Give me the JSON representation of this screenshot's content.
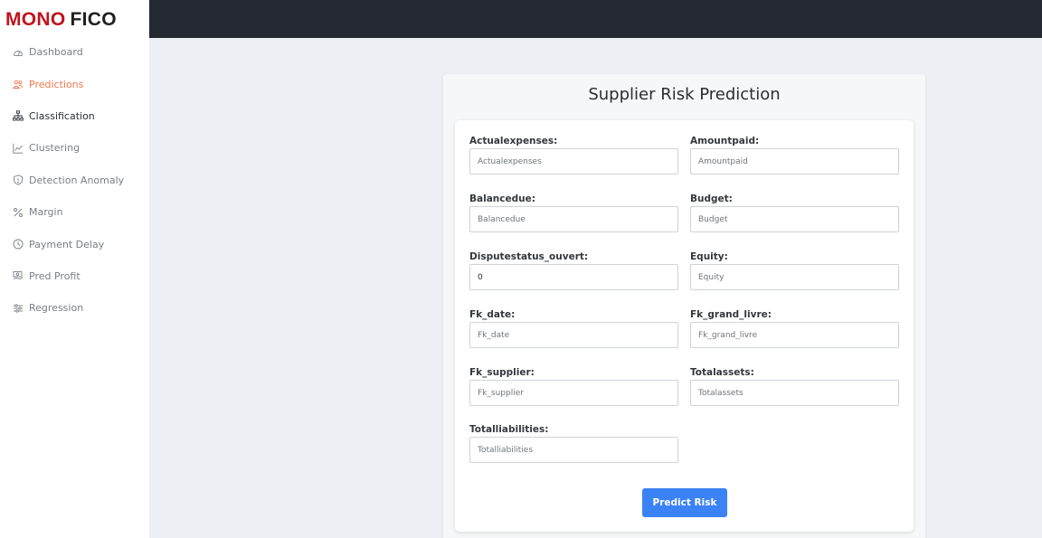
{
  "brand": {
    "part1": "MONO",
    "part2": "FICO"
  },
  "sidebar": {
    "items": [
      {
        "label": "Dashboard",
        "icon": "gauge-icon"
      },
      {
        "label": "Predictions",
        "icon": "users-icon"
      },
      {
        "label": "Classification",
        "icon": "sitemap-icon"
      },
      {
        "label": "Clustering",
        "icon": "line-chart-icon"
      },
      {
        "label": "Detection Anomaly",
        "icon": "shield-icon"
      },
      {
        "label": "Margin",
        "icon": "percent-icon"
      },
      {
        "label": "Payment Delay",
        "icon": "clock-icon"
      },
      {
        "label": "Pred Profit",
        "icon": "money-hand-icon"
      },
      {
        "label": "Regression",
        "icon": "sliders-icon"
      }
    ],
    "active": "Predictions"
  },
  "form": {
    "title": "Supplier Risk Prediction",
    "fields": [
      {
        "label": "Actualexpenses:",
        "placeholder": "Actualexpenses",
        "value": ""
      },
      {
        "label": "Amountpaid:",
        "placeholder": "Amountpaid",
        "value": ""
      },
      {
        "label": "Balancedue:",
        "placeholder": "Balancedue",
        "value": ""
      },
      {
        "label": "Budget:",
        "placeholder": "Budget",
        "value": ""
      },
      {
        "label": "Disputestatus_ouvert:",
        "placeholder": "",
        "value": "0"
      },
      {
        "label": "Equity:",
        "placeholder": "Equity",
        "value": ""
      },
      {
        "label": "Fk_date:",
        "placeholder": "Fk_date",
        "value": ""
      },
      {
        "label": "Fk_grand_livre:",
        "placeholder": "Fk_grand_livre",
        "value": ""
      },
      {
        "label": "Fk_supplier:",
        "placeholder": "Fk_supplier",
        "value": ""
      },
      {
        "label": "Totalassets:",
        "placeholder": "Totalassets",
        "value": ""
      },
      {
        "label": "Totalliabilities:",
        "placeholder": "Totalliabilities",
        "value": ""
      }
    ],
    "submit_label": "Predict Risk"
  },
  "colors": {
    "accent": "#3b82f6",
    "brand_red": "#c0141c",
    "active_nav": "#f0774a",
    "topbar": "#252932"
  }
}
